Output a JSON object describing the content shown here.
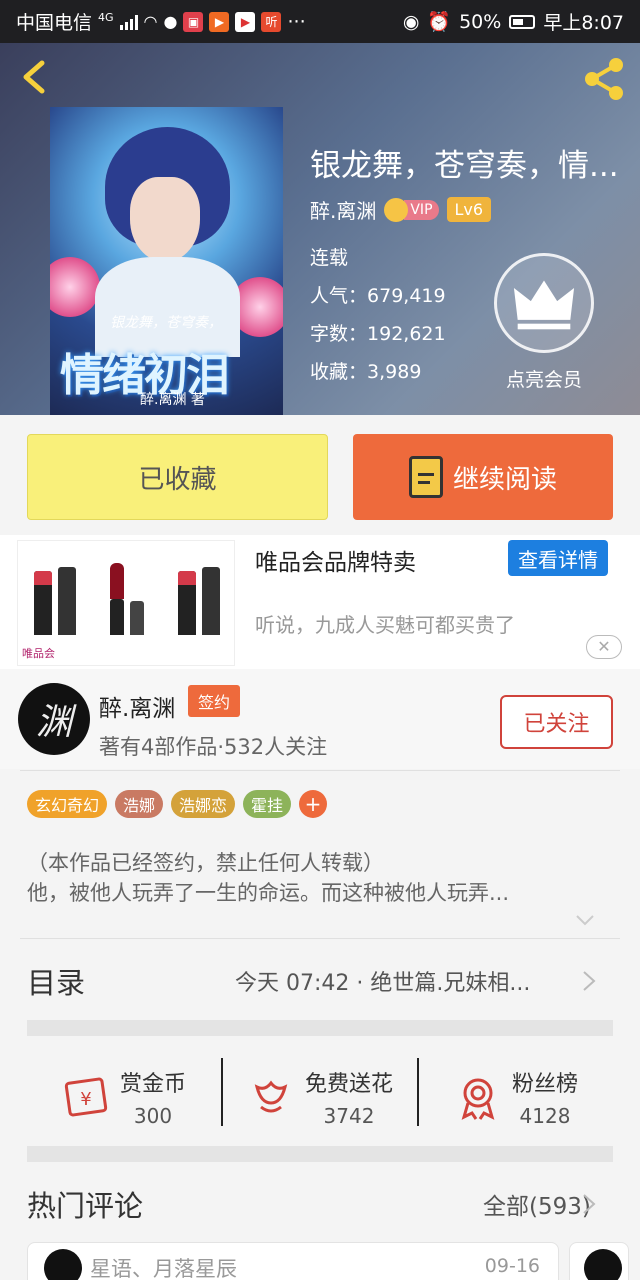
{
  "status_bar": {
    "carrier": "中国电信",
    "network": "4G",
    "more": "···",
    "battery": "50%",
    "time": "早上8:07"
  },
  "book": {
    "title": "银龙舞，苍穹奏，情...",
    "author": "醉.离渊",
    "vip": "VIP",
    "level": "Lv6",
    "status": "连载",
    "popularity_label": "人气：",
    "popularity": "679,419",
    "words_label": "字数：",
    "words": "192,621",
    "collects_label": "收藏：",
    "collects": "3,989",
    "member_label": "点亮会员",
    "cover": {
      "subtitle": "银龙舞，苍穹奏，",
      "title": "情绪初泪",
      "author": "醉.离渊 著"
    }
  },
  "actions": {
    "collected": "已收藏",
    "continue": "继续阅读"
  },
  "ad": {
    "title": "唯品会品牌特卖",
    "detail_button": "查看详情",
    "description": "听说，九成人买魅可都买贵了",
    "image_brand": "唯品会",
    "close": "✕"
  },
  "author_info": {
    "avatar_text": "渊",
    "name": "醉.离渊",
    "signed": "签约",
    "stats": "著有4部作品·532人关注",
    "follow": "已关注"
  },
  "tags": [
    {
      "label": "玄幻奇幻",
      "color": "#f0a22a"
    },
    {
      "label": "浩娜",
      "color": "#c97a63"
    },
    {
      "label": "浩娜恋",
      "color": "#d4a23a"
    },
    {
      "label": "霍挂",
      "color": "#8db35a"
    }
  ],
  "tag_more": "+",
  "description": {
    "line1": "（本作品已经签约，禁止任何人转载）",
    "line2": "他，被他人玩弄了一生的命运。而这种被他人玩弄..."
  },
  "toc": {
    "title": "目录",
    "latest": "今天 07:42 · 绝世篇.兄妹相..."
  },
  "stats": [
    {
      "label": "赏金币",
      "value": "300",
      "icon": "reward-icon"
    },
    {
      "label": "免费送花",
      "value": "3742",
      "icon": "flower-icon"
    },
    {
      "label": "粉丝榜",
      "value": "4128",
      "icon": "medal-icon"
    }
  ],
  "comments": {
    "title": "热门评论",
    "all": "全部(593)",
    "first": {
      "user": "星语、月落星辰",
      "date": "09-16"
    }
  },
  "colors": {
    "accent": "#ee6a3c",
    "collected_bg": "#f9f07a",
    "follow_red": "#d0433b",
    "ad_blue": "#1d7fe0"
  }
}
